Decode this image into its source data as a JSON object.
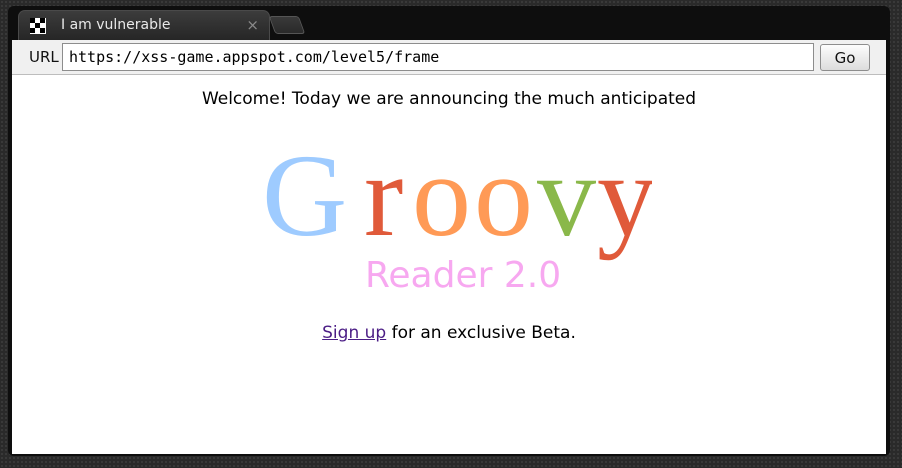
{
  "browser": {
    "tab_title": "I am vulnerable",
    "tab_close": "×",
    "url_label": "URL",
    "url_value": "https://xss-game.appspot.com/level5/frame",
    "go_label": "Go"
  },
  "page": {
    "welcome_text": "Welcome! Today we are announcing the much anticipated",
    "logo": {
      "word": "Groovy",
      "letters": [
        "G",
        "r",
        "o",
        "o",
        "v",
        "y"
      ],
      "letter_colors": [
        "#9ecbff",
        "#e05a3a",
        "#ff9a56",
        "#ff9a56",
        "#8ab84a",
        "#e05a3a"
      ],
      "subtitle": "Reader 2.0",
      "subtitle_color": "#f7a8f0"
    },
    "signup_link": "Sign up",
    "signup_rest": " for an exclusive Beta."
  }
}
